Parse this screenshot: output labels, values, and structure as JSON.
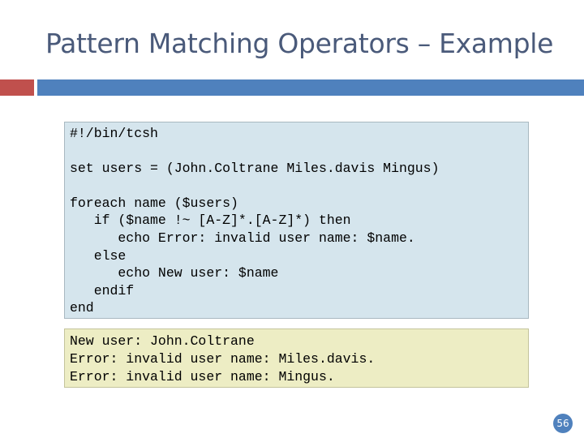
{
  "slide": {
    "title": "Pattern Matching Operators – Example",
    "page_number": "56",
    "accent_red": "#c0504d",
    "accent_blue": "#4f81bd"
  },
  "code": {
    "lines": [
      "#!/bin/tcsh",
      "set users = (John.Coltrane Miles.davis Mingus)",
      "foreach name ($users)",
      "   if ($name !~ [A-Z]*.[A-Z]*) then",
      "      echo Error: invalid user name: $name.",
      "   else",
      "      echo New user: $name",
      "   endif",
      "end"
    ]
  },
  "output": {
    "lines": [
      "New user: John.Coltrane",
      "Error: invalid user name: Miles.davis.",
      "Error: invalid user name: Mingus."
    ]
  }
}
